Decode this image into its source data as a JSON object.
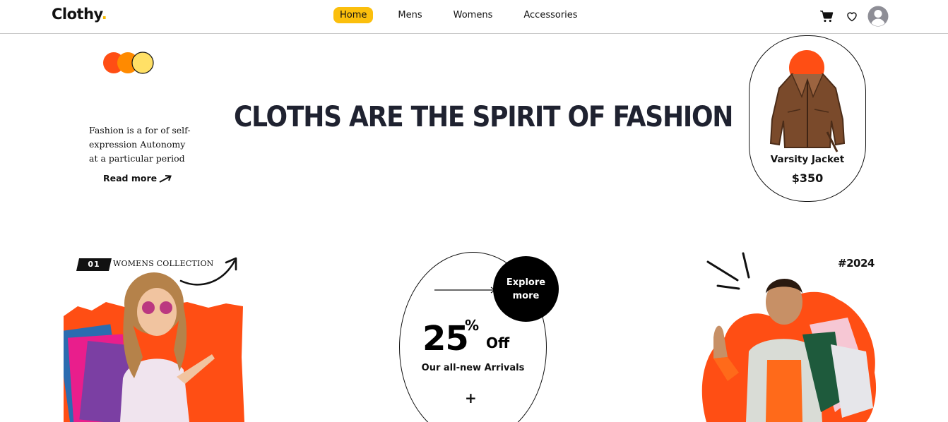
{
  "nav": {
    "logo_text": "Clothy",
    "logo_dot": ".",
    "links": [
      {
        "label": "Home",
        "active": true
      },
      {
        "label": "Mens",
        "active": false
      },
      {
        "label": "Womens",
        "active": false
      },
      {
        "label": "Accessories",
        "active": false
      }
    ],
    "icons": [
      "cart-icon",
      "heart-icon",
      "user-avatar-icon"
    ]
  },
  "hero": {
    "description": "Fashion is a for of self-expression Autonomy at a particular period",
    "read_more": "Read more",
    "title": "CLOTHS ARE THE SPIRIT OF FASHION",
    "dot_colors": [
      "#ff4e14",
      "#ff8a00",
      "#ffe066"
    ]
  },
  "product": {
    "name": "Varsity Jacket",
    "price": "$350"
  },
  "collection": {
    "number": "01",
    "label": "WOMENS COLLECTION"
  },
  "offer": {
    "explore_label": "Explore more",
    "percent": "25",
    "percent_sign": "%",
    "off": "Off",
    "subtitle": "Our all-new Arrivals",
    "plus": "+"
  },
  "year_tag": "#2024",
  "colors": {
    "accent_yellow": "#fbbf0d",
    "accent_orange": "#ff4e14",
    "text_dark": "#1f2230"
  }
}
